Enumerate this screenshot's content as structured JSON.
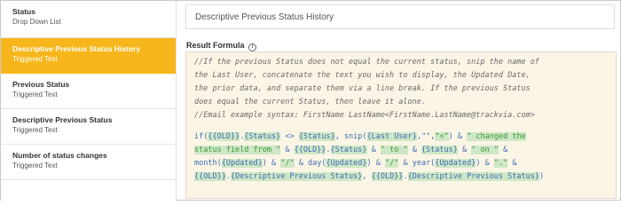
{
  "sidebar": {
    "items": [
      {
        "name": "Status",
        "type": "Drop Down List"
      },
      {
        "name": "Descriptive Previous Status History",
        "type": "Triggered Text",
        "active": true
      },
      {
        "name": "Previous Status",
        "type": "Triggered Text"
      },
      {
        "name": "Descriptive Previous Status",
        "type": "Triggered Text"
      },
      {
        "name": "Number of status changes",
        "type": "Triggered Text"
      }
    ]
  },
  "field_name": {
    "value": "Descriptive Previous Status History"
  },
  "formula": {
    "label": "Result Formula",
    "info_icon": "info-circle-icon",
    "comment_lines": [
      "//If the previous Status does not equal the current status, snip the name of",
      "the Last User, concatenate the text you wish to display, the Updated Date,",
      "the prior data, and separate them via a line break. If the previous Status",
      "does equal the current Status, then leave it alone.",
      "//Email example syntax: FirstName LastName<FirstName.LastName@trackvia.com>"
    ],
    "code": {
      "l1a": "if(",
      "l1b": "{{OLD}}",
      "l1c": ".",
      "l1d": "{Status}",
      "l1e": " <> ",
      "l1f": "{Status}",
      "l1g": ", snip(",
      "l1h": "{Last User}",
      "l1i": ",\"\",",
      "l1j": "\"<\"",
      "l1k": ") & ",
      "l1l": "\" changed the",
      "l2a": "status field from \"",
      "l2b": " & ",
      "l2c": "{{OLD}}",
      "l2d": ".",
      "l2e": "{Status}",
      "l2f": " & ",
      "l2g": "\" to \"",
      "l2h": " & ",
      "l2i": "{Status}",
      "l2j": " & ",
      "l2k": "\" on \"",
      "l2l": " &",
      "l3a": "month(",
      "l3b": "{Updated}",
      "l3c": ") & ",
      "l3d": "\"/\"",
      "l3e": " & day(",
      "l3f": "{Updated}",
      "l3g": ") & ",
      "l3h": "\"/\"",
      "l3i": " & year(",
      "l3j": "{Updated}",
      "l3k": ") & ",
      "l3l": "\".\"",
      "l3m": " &",
      "l4a": "{{OLD}}",
      "l4b": ".",
      "l4c": "{Descriptive Previous Status}",
      "l4d": ", ",
      "l4e": "{{OLD}}",
      "l4f": ".",
      "l4g": "{Descriptive Previous Status}",
      "l4h": ")"
    }
  },
  "colors": {
    "active_item": "#f7b61b",
    "editor_background": "#fbf5e6",
    "code_text": "#3b6db3",
    "string_text": "#3a9a32",
    "highlight": "#cfe7c6"
  }
}
